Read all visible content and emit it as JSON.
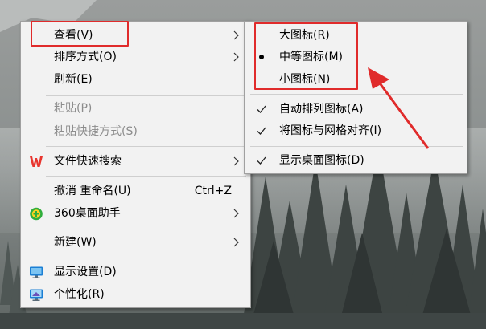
{
  "context_menu": {
    "view": "查看(V)",
    "sort_by": "排序方式(O)",
    "refresh": "刷新(E)",
    "paste": "粘贴(P)",
    "paste_shortcut": "粘贴快捷方式(S)",
    "wps_search": "文件快速搜索",
    "undo_rename": "撤消 重命名(U)",
    "undo_shortcut": "Ctrl+Z",
    "desk_assistant": "360桌面助手",
    "new": "新建(W)",
    "display_settings": "显示设置(D)",
    "personalize": "个性化(R)"
  },
  "view_submenu": {
    "large_icons": "大图标(R)",
    "medium_icons": "中等图标(M)",
    "small_icons": "小图标(N)",
    "auto_arrange": "自动排列图标(A)",
    "align_to_grid": "将图标与网格对齐(I)",
    "show_desktop_icons": "显示桌面图标(D)",
    "selected": "medium_icons",
    "checked": [
      "auto_arrange",
      "align_to_grid",
      "show_desktop_icons"
    ]
  },
  "colors": {
    "menu_background": "#f2f2f2",
    "highlight_red": "#e02b2b",
    "disabled_text": "#8c8c8c",
    "wps_red": "#e8352e",
    "assistant_green": "#2fae3d",
    "assistant_yellow": "#ffd21f",
    "monitor_blue": "#1b7fd4"
  },
  "icons": {
    "chevron": "chevron-right-icon",
    "wps": "wps-w-icon",
    "desk_assistant": "360-assistant-icon",
    "display_settings": "monitor-icon",
    "personalize": "personalize-monitor-icon",
    "check": "checkmark-icon",
    "radio": "radio-dot-icon"
  }
}
